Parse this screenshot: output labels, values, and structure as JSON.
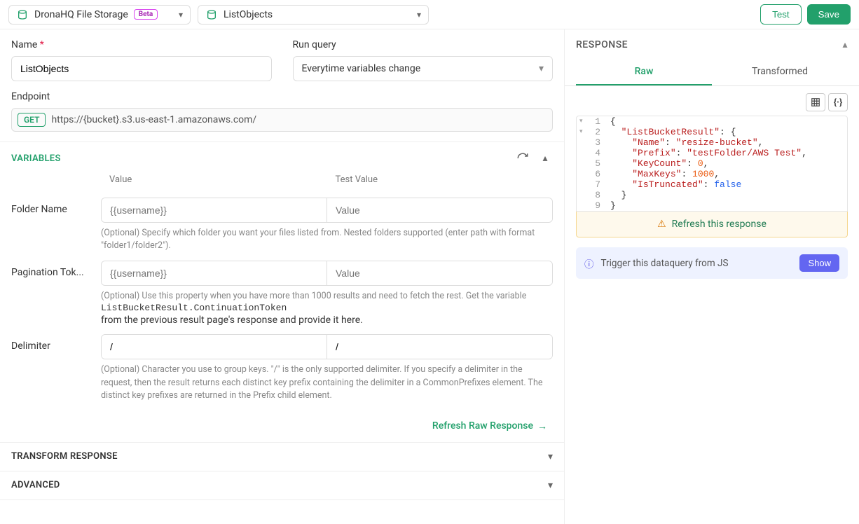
{
  "topbar": {
    "connector_label": "DronaHQ File Storage",
    "connector_badge": "Beta",
    "query_label": "ListObjects",
    "test_label": "Test",
    "save_label": "Save"
  },
  "form": {
    "name_label": "Name",
    "name_value": "ListObjects",
    "runquery_label": "Run query",
    "runquery_value": "Everytime variables change",
    "endpoint_label": "Endpoint",
    "method": "GET",
    "url": "https://{bucket}.s3.us-east-1.amazonaws.com/"
  },
  "variables": {
    "title": "VARIABLES",
    "col_value": "Value",
    "col_test": "Test Value",
    "rows": [
      {
        "label": "Folder Name",
        "value_ph": "{{username}}",
        "test_ph": "Value",
        "help": "(Optional) Specify which folder you want your files listed from. Nested folders supported (enter path with format \"folder1/folder2\")."
      },
      {
        "label": "Pagination Tok...",
        "value_ph": "{{username}}",
        "test_ph": "Value",
        "help1": "(Optional) Use this property when you have more than 1000 results and need to fetch the rest. Get the variable",
        "mono": "ListBucketResult.ContinuationToken",
        "help2": "from the previous result page's response and provide it here."
      },
      {
        "label": "Delimiter",
        "value": "/",
        "test": "/",
        "help": "(Optional) Character you use to group keys. \"/\" is the only supported delimiter. If you specify a delimiter in the request, then the result returns each distinct key prefix containing the delimiter in a CommonPrefixes element. The distinct key prefixes are returned in the Prefix child element."
      }
    ],
    "refresh_label": "Refresh Raw Response"
  },
  "sections": {
    "transform": "TRANSFORM RESPONSE",
    "advanced": "ADVANCED"
  },
  "response": {
    "title": "RESPONSE",
    "tab_raw": "Raw",
    "tab_transformed": "Transformed",
    "refresh_warn": "Refresh this response",
    "trigger_info": "Trigger this dataquery from JS",
    "show_label": "Show",
    "json": {
      "ListBucketResult": {
        "Name": "resize-bucket",
        "Prefix": "testFolder/AWS Test",
        "KeyCount": 0,
        "MaxKeys": 1000,
        "IsTruncated": false
      }
    }
  }
}
